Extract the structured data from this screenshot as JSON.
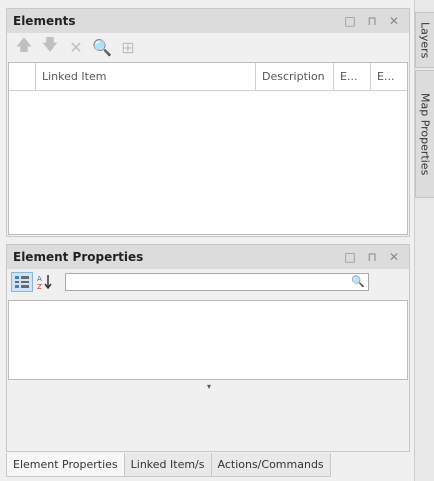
{
  "elements_panel": {
    "title": "Elements",
    "header_buttons": [
      "□",
      "⊓",
      "✕"
    ],
    "toolbar": {
      "move_up": "🡅",
      "move_down": "🡇",
      "delete": "✕",
      "find": "🔍",
      "grid_view": "⊞"
    },
    "columns": [
      "",
      "Linked Item",
      "Description",
      "E...",
      "E..."
    ]
  },
  "properties_panel": {
    "title": "Element Properties",
    "header_buttons": [
      "□",
      "⊓",
      "✕"
    ],
    "categorized_icon": "categorized-icon",
    "sort_icon": "sort-az-icon",
    "search_value": "",
    "search_icon": "🔍",
    "collapse_glyph": "▾"
  },
  "bottom_tabs": [
    "Element Properties",
    "Linked Item/s",
    "Actions/Commands"
  ],
  "side_tabs": [
    "Layers",
    "Map Properties"
  ]
}
